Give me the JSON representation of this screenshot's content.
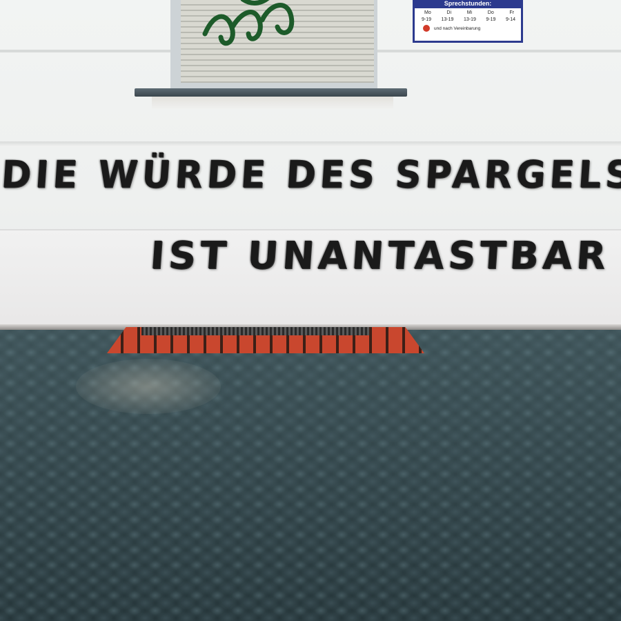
{
  "graffiti": {
    "line1": "DIE WÜRDE DES SPARGELS",
    "line2": "IST UNANTASTBAR"
  },
  "sign": {
    "title": "Sprechstunden:",
    "days": [
      "Mo",
      "Di",
      "Mi",
      "Do",
      "Fr"
    ],
    "hours": [
      "9-19",
      "13-19",
      "13-19",
      "9-19",
      "9-14"
    ],
    "note": "und nach Vereinbarung"
  }
}
